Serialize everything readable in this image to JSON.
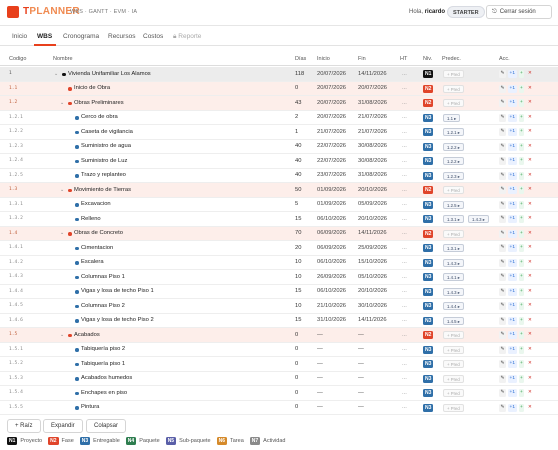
{
  "app": {
    "logo_t": "T",
    "logo_rest": "PLANNER",
    "modules": "WBS · GANTT · EVM · IA",
    "greeting_prefix": "Hola,",
    "user": "ricardo",
    "plan": "STARTER",
    "logout": "Cerrar sesión"
  },
  "tabs": [
    "Inicio",
    "WBS",
    "Cronograma",
    "Recursos",
    "Costos",
    "Reporte"
  ],
  "columns": {
    "code": "Codigo",
    "name": "Nombre",
    "days": "Días",
    "start": "Inicio",
    "end": "Fin",
    "ht": "HT",
    "level": "Niv.",
    "pred": "Predec.",
    "acts": "Acc."
  },
  "actions": {
    "edit": "✎",
    "add": "+1",
    "plus": "+",
    "delete": "✕"
  },
  "level_colors": {
    "N1": "#111111",
    "N2": "#e0442a",
    "N3": "#2f6fa8",
    "N4": "#2e7d4f",
    "N5": "#5a5fa8",
    "N6": "#d58a2a",
    "N7": "#8a8a8a"
  },
  "rows": [
    {
      "code": "1",
      "name": "Vivienda Unifamiliar Los Alamos",
      "days": "118",
      "start": "20/07/2026",
      "end": "14/11/2026",
      "ht": "...",
      "level": "N1",
      "pred": "+ Pred",
      "pred2": ""
    },
    {
      "code": "1.1",
      "name": "Inicio de Obra",
      "days": "0",
      "start": "20/07/2026",
      "end": "20/07/2026",
      "ht": "...",
      "level": "N2",
      "pred": "+ Pred",
      "pred2": ""
    },
    {
      "code": "1.2",
      "name": "Obras Preliminares",
      "days": "43",
      "start": "20/07/2026",
      "end": "31/08/2026",
      "ht": "...",
      "level": "N2",
      "pred": "+ Pred",
      "pred2": ""
    },
    {
      "code": "1.2.1",
      "name": "Cerco de obra",
      "days": "2",
      "start": "20/07/2026",
      "end": "21/07/2026",
      "ht": "...",
      "level": "N3",
      "pred": "1.1 ▸",
      "pred2": ""
    },
    {
      "code": "1.2.2",
      "name": "Caseta de vigilancia",
      "days": "1",
      "start": "21/07/2026",
      "end": "21/07/2026",
      "ht": "...",
      "level": "N3",
      "pred": "1.2.1 ▸",
      "pred2": ""
    },
    {
      "code": "1.2.3",
      "name": "Suministro de agua",
      "days": "40",
      "start": "22/07/2026",
      "end": "30/08/2026",
      "ht": "...",
      "level": "N3",
      "pred": "1.2.2 ▸",
      "pred2": ""
    },
    {
      "code": "1.2.4",
      "name": "Suministro de Luz",
      "days": "40",
      "start": "22/07/2026",
      "end": "30/08/2026",
      "ht": "...",
      "level": "N3",
      "pred": "1.2.2 ▸",
      "pred2": ""
    },
    {
      "code": "1.2.5",
      "name": "Trazo y replanteo",
      "days": "40",
      "start": "23/07/2026",
      "end": "31/08/2026",
      "ht": "...",
      "level": "N3",
      "pred": "1.2.3 ▸",
      "pred2": ""
    },
    {
      "code": "1.3",
      "name": "Movimiento de Tierras",
      "days": "50",
      "start": "01/09/2026",
      "end": "20/10/2026",
      "ht": "...",
      "level": "N2",
      "pred": "+ Pred",
      "pred2": ""
    },
    {
      "code": "1.3.1",
      "name": "Excavacion",
      "days": "5",
      "start": "01/09/2026",
      "end": "05/09/2026",
      "ht": "...",
      "level": "N3",
      "pred": "1.2.5 ▸",
      "pred2": ""
    },
    {
      "code": "1.3.2",
      "name": "Relleno",
      "days": "15",
      "start": "06/10/2026",
      "end": "20/10/2026",
      "ht": "...",
      "level": "N3",
      "pred": "1.3.1 ▸",
      "pred2": "1.4.3 ▸"
    },
    {
      "code": "1.4",
      "name": "Obras de Concreto",
      "days": "70",
      "start": "06/09/2026",
      "end": "14/11/2026",
      "ht": "...",
      "level": "N2",
      "pred": "+ Pred",
      "pred2": ""
    },
    {
      "code": "1.4.1",
      "name": "Cimentacion",
      "days": "20",
      "start": "06/09/2026",
      "end": "25/09/2026",
      "ht": "...",
      "level": "N3",
      "pred": "1.3.1 ▸",
      "pred2": ""
    },
    {
      "code": "1.4.2",
      "name": "Escalera",
      "days": "10",
      "start": "06/10/2026",
      "end": "15/10/2026",
      "ht": "...",
      "level": "N3",
      "pred": "1.4.3 ▸",
      "pred2": ""
    },
    {
      "code": "1.4.3",
      "name": "Columnas Piso 1",
      "days": "10",
      "start": "26/09/2026",
      "end": "05/10/2026",
      "ht": "...",
      "level": "N3",
      "pred": "1.4.1 ▸",
      "pred2": ""
    },
    {
      "code": "1.4.4",
      "name": "Vigas y losa de techo Piso 1",
      "days": "15",
      "start": "06/10/2026",
      "end": "20/10/2026",
      "ht": "...",
      "level": "N3",
      "pred": "1.4.3 ▸",
      "pred2": ""
    },
    {
      "code": "1.4.5",
      "name": "Columnas Piso 2",
      "days": "10",
      "start": "21/10/2026",
      "end": "30/10/2026",
      "ht": "...",
      "level": "N3",
      "pred": "1.4.4 ▸",
      "pred2": ""
    },
    {
      "code": "1.4.6",
      "name": "Vigas y losa de techo Piso 2",
      "days": "15",
      "start": "31/10/2026",
      "end": "14/11/2026",
      "ht": "...",
      "level": "N3",
      "pred": "1.4.5 ▸",
      "pred2": ""
    },
    {
      "code": "1.5",
      "name": "Acabados",
      "days": "0",
      "start": "—",
      "end": "—",
      "ht": "...",
      "level": "N2",
      "pred": "+ Pred",
      "pred2": ""
    },
    {
      "code": "1.5.1",
      "name": "Tabiquería piso 2",
      "days": "0",
      "start": "—",
      "end": "—",
      "ht": "...",
      "level": "N3",
      "pred": "+ Pred",
      "pred2": ""
    },
    {
      "code": "1.5.2",
      "name": "Tabiquería piso 1",
      "days": "0",
      "start": "—",
      "end": "—",
      "ht": "...",
      "level": "N3",
      "pred": "+ Pred",
      "pred2": ""
    },
    {
      "code": "1.5.3",
      "name": "Acabados humedos",
      "days": "0",
      "start": "—",
      "end": "—",
      "ht": "...",
      "level": "N3",
      "pred": "+ Pred",
      "pred2": ""
    },
    {
      "code": "1.5.4",
      "name": "Enchapes en piso",
      "days": "0",
      "start": "—",
      "end": "—",
      "ht": "...",
      "level": "N3",
      "pred": "+ Pred",
      "pred2": ""
    },
    {
      "code": "1.5.5",
      "name": "Pintura",
      "days": "0",
      "start": "—",
      "end": "—",
      "ht": "...",
      "level": "N3",
      "pred": "+ Pred",
      "pred2": ""
    }
  ],
  "bottom_buttons": {
    "root": "+ Raíz",
    "expand": "Expandir",
    "collapse": "Colapsar"
  },
  "legend": [
    {
      "badge": "N1",
      "label": "Proyecto"
    },
    {
      "badge": "N2",
      "label": "Fase"
    },
    {
      "badge": "N3",
      "label": "Entregable"
    },
    {
      "badge": "N4",
      "label": "Paquete"
    },
    {
      "badge": "N5",
      "label": "Sub-paquete"
    },
    {
      "badge": "N6",
      "label": "Tarea"
    },
    {
      "badge": "N7",
      "label": "Actividad"
    }
  ]
}
